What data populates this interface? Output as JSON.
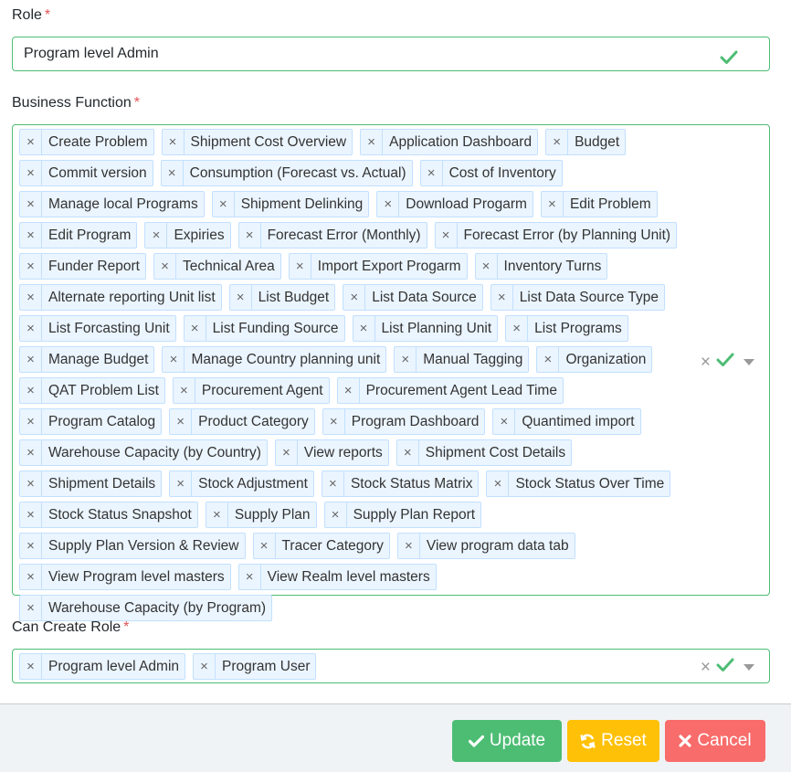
{
  "role": {
    "label": "Role",
    "required_mark": "*",
    "value": "Program level Admin"
  },
  "business_function": {
    "label": "Business Function",
    "required_mark": "*",
    "tags": [
      "Create Problem",
      "Shipment Cost Overview",
      "Application Dashboard",
      "Budget",
      "Commit version",
      "Consumption (Forecast vs. Actual)",
      "Cost of Inventory",
      "Manage local Programs",
      "Shipment Delinking",
      "Download Progarm",
      "Edit Problem",
      "Edit Program",
      "Expiries",
      "Forecast Error (Monthly)",
      "Forecast Error (by Planning Unit)",
      "Funder Report",
      "Technical Area",
      "Import Export Progarm",
      "Inventory Turns",
      "Alternate reporting Unit list",
      "List Budget",
      "List Data Source",
      "List Data Source Type",
      "List Forcasting Unit",
      "List Funding Source",
      "List Planning Unit",
      "List Programs",
      "Manage Budget",
      "Manage Country planning unit",
      "Manual Tagging",
      "Organization",
      "QAT Problem List",
      "Procurement Agent",
      "Procurement Agent Lead Time",
      "Program Catalog",
      "Product Category",
      "Program Dashboard",
      "Quantimed import",
      "Warehouse Capacity (by Country)",
      "View reports",
      "Shipment Cost Details",
      "Shipment Details",
      "Stock Adjustment",
      "Stock Status Matrix",
      "Stock Status Over Time",
      "Stock Status Snapshot",
      "Supply Plan",
      "Supply Plan Report",
      "Supply Plan Version & Review",
      "Tracer Category",
      "View program data tab",
      "View Program level masters",
      "View Realm level masters",
      "Warehouse Capacity (by Program)"
    ]
  },
  "can_create_role": {
    "label": "Can Create Role",
    "required_mark": "*",
    "tags": [
      "Program level Admin",
      "Program User"
    ]
  },
  "buttons": {
    "update": "Update",
    "reset": "Reset",
    "cancel": "Cancel"
  },
  "icons": {
    "remove": "×",
    "clear": "×",
    "valid": "check-icon",
    "dropdown": "chevron-down-icon"
  },
  "colors": {
    "valid_green": "#4dbd74",
    "tag_bg": "#ebf5ff",
    "tag_border": "#c2e0ff",
    "update_btn": "#4dbd74",
    "reset_btn": "#ffc107",
    "cancel_btn": "#f86c6b",
    "required": "#e55353"
  }
}
